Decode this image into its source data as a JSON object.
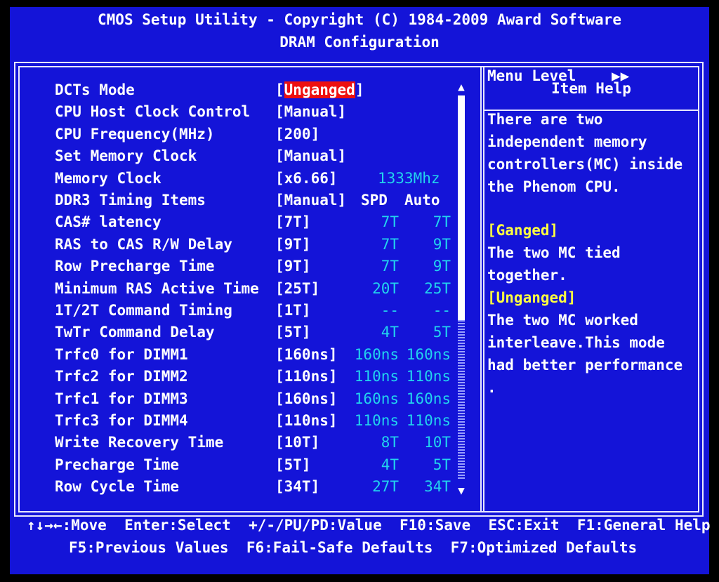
{
  "header": {
    "title": "CMOS Setup Utility - Copyright (C) 1984-2009 Award Software",
    "subtitle": "DRAM Configuration"
  },
  "settings": [
    {
      "label": "DCTs Mode",
      "value": "Unganged",
      "selected": true
    },
    {
      "label": "CPU Host Clock Control",
      "value": "[Manual]"
    },
    {
      "label": "CPU Frequency(MHz)",
      "value": "[200]"
    },
    {
      "label": "Set Memory Clock",
      "value": "[Manual]"
    },
    {
      "label": "Memory Clock",
      "value": "[x6.66]",
      "extra": "1333Mhz"
    },
    {
      "label": "DDR3 Timing Items",
      "value": "[Manual]",
      "col_spd": "SPD",
      "col_auto": "Auto"
    },
    {
      "label": "CAS# latency",
      "value": "[7T]",
      "spd": "7T",
      "auto": "7T"
    },
    {
      "label": "RAS to CAS R/W Delay",
      "value": "[9T]",
      "spd": "7T",
      "auto": "9T"
    },
    {
      "label": "Row Precharge Time",
      "value": "[9T]",
      "spd": "7T",
      "auto": "9T"
    },
    {
      "label": "Minimum RAS Active Time",
      "value": "[25T]",
      "spd": "20T",
      "auto": "25T"
    },
    {
      "label": "1T/2T Command Timing",
      "value": "[1T]",
      "spd": "--",
      "auto": "--"
    },
    {
      "label": "TwTr Command Delay",
      "value": "[5T]",
      "spd": "4T",
      "auto": "5T"
    },
    {
      "label": "Trfc0 for DIMM1",
      "value": "[160ns]",
      "spd": "160ns",
      "auto": "160ns"
    },
    {
      "label": "Trfc2 for DIMM2",
      "value": "[110ns]",
      "spd": "110ns",
      "auto": "110ns"
    },
    {
      "label": "Trfc1 for DIMM3",
      "value": "[160ns]",
      "spd": "160ns",
      "auto": "160ns"
    },
    {
      "label": "Trfc3 for DIMM4",
      "value": "[110ns]",
      "spd": "110ns",
      "auto": "110ns"
    },
    {
      "label": "Write Recovery Time",
      "value": "[10T]",
      "spd": "8T",
      "auto": "10T"
    },
    {
      "label": "Precharge Time",
      "value": "[5T]",
      "spd": "4T",
      "auto": "5T"
    },
    {
      "label": "Row Cycle Time",
      "value": "[34T]",
      "spd": "27T",
      "auto": "34T"
    }
  ],
  "help": {
    "title": "Item Help",
    "menu_level_label": "Menu Level",
    "menu_level_arrows": "▶▶",
    "intro": "There are two\nindependent memory\ncontrollers(MC) inside\nthe Phenom CPU.",
    "ganged_label": "[Ganged]",
    "ganged_text": "The two MC tied\ntogether.",
    "unganged_label": "[Unganged]",
    "unganged_text": "The two MC worked\ninterleave.This mode\nhad better performance\n."
  },
  "footer": {
    "line1": "↑↓→←:Move  Enter:Select  +/-/PU/PD:Value  F10:Save  ESC:Exit  F1:General Help",
    "line2": "F5:Previous Values  F6:Fail-Safe Defaults  F7:Optimized Defaults"
  },
  "colors": {
    "background": "#1414d8",
    "highlight": "#ee1010",
    "secondary_text": "#22d4ee",
    "help_keyword": "#ffff40"
  },
  "icons": {
    "scroll_up": "scroll-up-arrow-icon",
    "scroll_down": "scroll-down-arrow-icon"
  }
}
